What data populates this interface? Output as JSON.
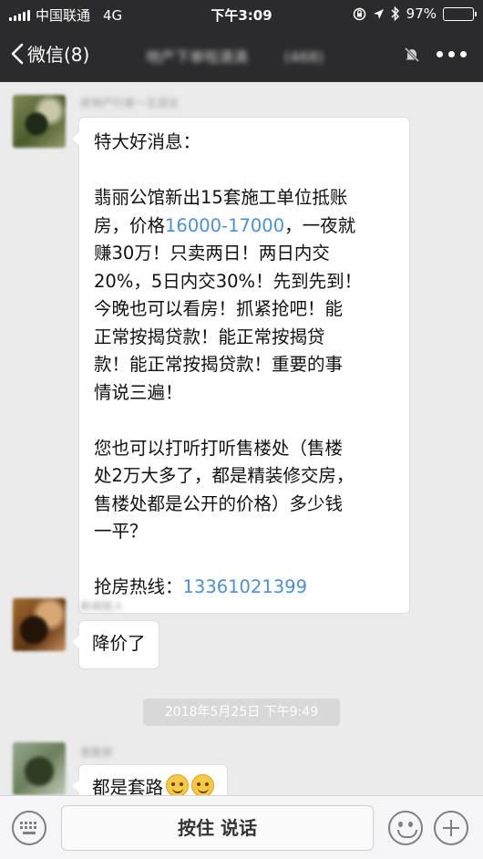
{
  "status_bar": {
    "carrier": "中国联通",
    "network": "4G",
    "time": "下午3:09",
    "battery_percent": "97%",
    "battery_level": 0.97,
    "icons": [
      "signal-icon",
      "rotation-lock-icon",
      "location-icon",
      "bluetooth-icon",
      "battery-icon"
    ]
  },
  "nav": {
    "back_label": "微信(8)",
    "title": "地产下单啦滴滴",
    "member_count": "(468)",
    "icons": [
      "back-chevron-icon",
      "mute-bell-icon",
      "more-icon"
    ]
  },
  "messages": [
    {
      "sender": "房地产行者一王润业",
      "avatar_icon": "avatar-photo",
      "lines": [
        "特大好消息：",
        "",
        "翡丽公馆新出15套施工单位抵账",
        [
          "房，价格",
          "16000-17000",
          "，一夜就"
        ],
        "赚30万！只卖两日！两日内交",
        "20%，5日内交30%！先到先到！",
        "今晚也可以看房！抓紧抢吧！能",
        "正常按揭贷款！能正常按揭贷",
        "款！能正常按揭贷款！重要的事",
        "情说三遍！",
        "",
        "您也可以打听打听售楼处（售楼",
        "处2万大多了，都是精装修交房，",
        "售楼处都是公开的价格）多少钱",
        "一平？",
        "",
        [
          "抢房热线：",
          "13361021399"
        ]
      ]
    },
    {
      "sender": "新闻就人",
      "avatar_icon": "avatar-photo",
      "text": "降价了"
    },
    {
      "sender": "张歌安",
      "avatar_icon": "avatar-photo",
      "text": "都是套路",
      "emoji_icons": [
        "smirk-emoji-icon",
        "smirk-emoji-icon"
      ]
    }
  ],
  "timestamp": "2018年5月25日 下午9:49",
  "input_bar": {
    "talk_label": "按住 说话",
    "icons": [
      "keyboard-icon",
      "emoji-icon",
      "plus-icon"
    ]
  },
  "colors": {
    "nav_background": "#2b2b2d",
    "chat_background": "#ebebeb",
    "link": "#4a90d9",
    "battery": "#4cd964"
  }
}
